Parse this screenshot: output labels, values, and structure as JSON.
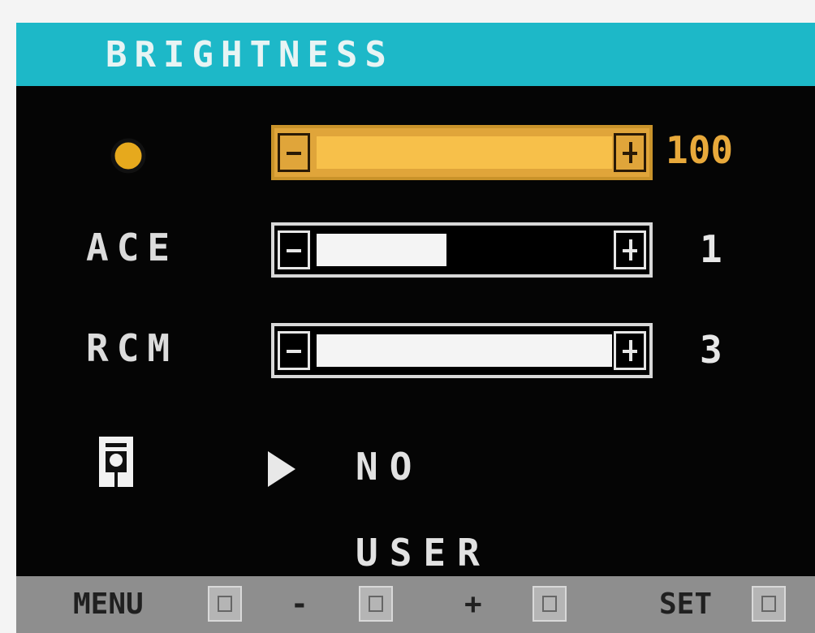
{
  "header": {
    "title": "BRIGHTNESS"
  },
  "rows": [
    {
      "label": "",
      "icon": "brightness-sun-icon",
      "value": "100",
      "level": 1.0,
      "active": true
    },
    {
      "label": "ACE",
      "icon": "",
      "value": "1",
      "level": 0.44,
      "active": false
    },
    {
      "label": "RCM",
      "icon": "",
      "value": "3",
      "level": 1.0,
      "active": false
    }
  ],
  "mode": {
    "icon": "preset-mode-icon",
    "options": [
      "NO",
      "USER"
    ],
    "selected": "NO"
  },
  "footer": {
    "menu_label": "MENU",
    "minus_label": "-",
    "plus_label": "+",
    "set_label": "SET"
  },
  "colors": {
    "header": "#1db8c8",
    "active_bar": "#f7c04a",
    "active_value": "#e8a93b"
  }
}
